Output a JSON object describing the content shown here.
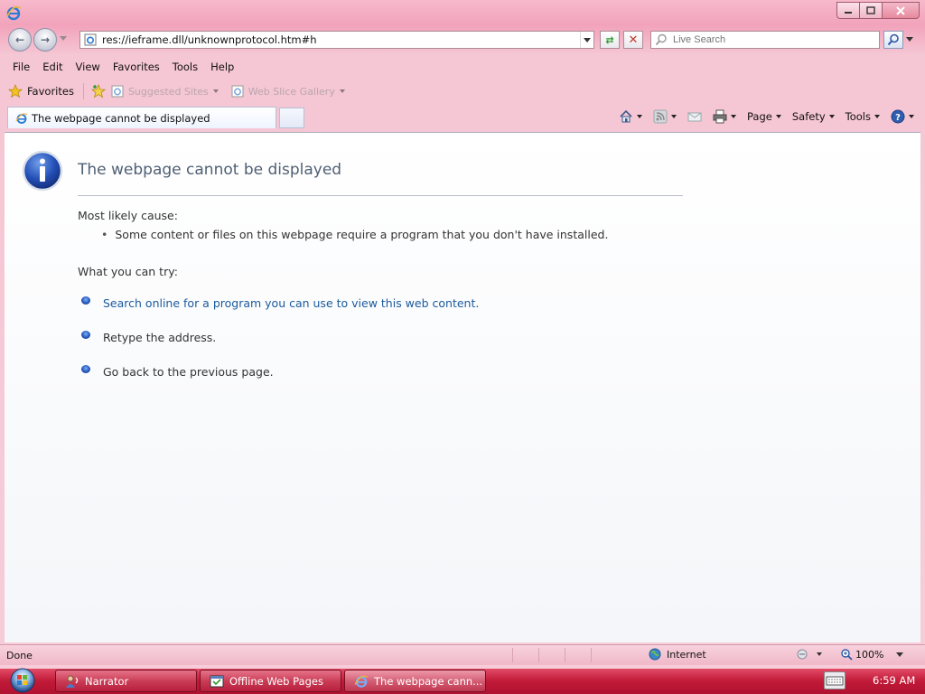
{
  "browser": {
    "address": "res://ieframe.dll/unknownprotocol.htm#h",
    "search_placeholder": "Live Search",
    "menu": [
      "File",
      "Edit",
      "View",
      "Favorites",
      "Tools",
      "Help"
    ],
    "favorites_label": "Favorites",
    "favorites_links": [
      "Suggested Sites",
      "Web Slice Gallery"
    ],
    "tab_title": "The webpage cannot be displayed",
    "commands": {
      "page": "Page",
      "safety": "Safety",
      "tools": "Tools"
    }
  },
  "error_page": {
    "title": "The webpage cannot be displayed",
    "likely_cause_label": "Most likely cause:",
    "cause": "Some content or files on this webpage require a program that you don't have installed.",
    "try_label": "What you can try:",
    "options": [
      {
        "text": "Search online for a program you can use to view this web content.",
        "link": true
      },
      {
        "text": "Retype the address.",
        "link": false
      },
      {
        "text": "Go back to the previous page.",
        "link": false
      }
    ]
  },
  "status": {
    "text": "Done",
    "zone": "Internet",
    "zoom": "100%"
  },
  "taskbar": {
    "items": [
      "Narrator",
      "Offline Web Pages",
      "The webpage cann..."
    ],
    "clock": "6:59 AM"
  },
  "colors": {
    "frame": "#f5c6d3",
    "taskbar": "#c01a38",
    "link": "#1b5a9c",
    "title_text": "#4f5f74"
  }
}
